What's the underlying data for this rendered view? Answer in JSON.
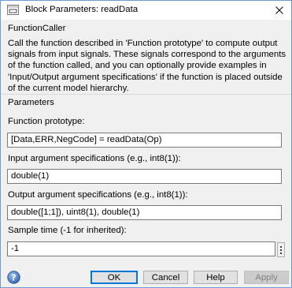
{
  "window": {
    "title": "Block Parameters: readData"
  },
  "description": {
    "header": "FunctionCaller",
    "text": "Call the function described in 'Function prototype' to compute output signals from input signals. These signals correspond to the arguments of the function called, and you can optionally provide examples in 'Input/Output argument specifications' if the function is placed outside of the current model hierarchy."
  },
  "parameters": {
    "header": "Parameters",
    "prototype_label": "Function prototype:",
    "prototype_value": "[Data,ERR,NegCode] = readData(Op)",
    "input_label": "Input argument specifications (e.g., int8(1)):",
    "input_value": "double(1)",
    "output_label": "Output argument specifications (e.g., int8(1)):",
    "output_value": "double([1;1]), uint8(1), double(1)",
    "sample_label": "Sample time (-1 for inherited):",
    "sample_value": "-1"
  },
  "buttons": {
    "ok": "OK",
    "cancel": "Cancel",
    "help": "Help",
    "apply": "Apply"
  },
  "icons": {
    "app": "simulink-block-icon",
    "close": "close-icon",
    "help": "help-icon",
    "more": "more-options-icon"
  },
  "colors": {
    "accent": "#0078d7",
    "window_bg": "#f0f0f0",
    "disabled_text": "#838383"
  }
}
